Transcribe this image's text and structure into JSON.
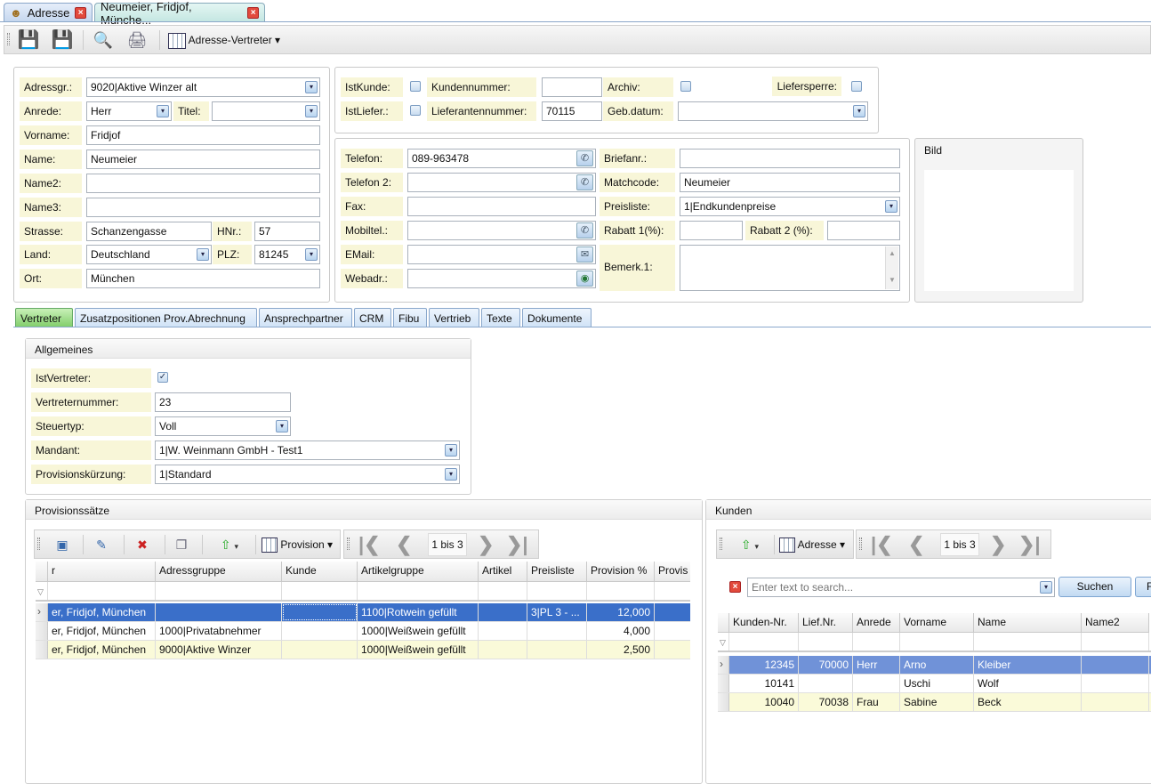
{
  "tabs": [
    {
      "label": "Adresse",
      "icon": "address-book-icon"
    },
    {
      "label": "Neumeier, Fridjof, Münche..."
    }
  ],
  "toolbar": {
    "view_label": "Adresse-Vertreter"
  },
  "address": {
    "adressgr_label": "Adressgr.:",
    "adressgr": "9020|Aktive Winzer alt",
    "anrede_label": "Anrede:",
    "anrede": "Herr",
    "titel_label": "Titel:",
    "titel": "",
    "vorname_label": "Vorname:",
    "vorname": "Fridjof",
    "name_label": "Name:",
    "name": "Neumeier",
    "name2_label": "Name2:",
    "name2": "",
    "name3_label": "Name3:",
    "name3": "",
    "strasse_label": "Strasse:",
    "strasse": "Schanzengasse",
    "hnr_label": "HNr.:",
    "hnr": "57",
    "land_label": "Land:",
    "land": "Deutschland",
    "plz_label": "PLZ:",
    "plz": "81245",
    "ort_label": "Ort:",
    "ort": "München"
  },
  "flags": {
    "istkunde_label": "IstKunde:",
    "istkunde": false,
    "kundennummer_label": "Kundennummer:",
    "kundennummer": "",
    "archiv_label": "Archiv:",
    "archiv": false,
    "liefersperre_label": "Liefersperre:",
    "liefersperre": false,
    "istliefer_label": "IstLiefer.:",
    "istliefer": false,
    "lieferantennummer_label": "Lieferantennummer:",
    "lieferantennummer": "70115",
    "gebdatum_label": "Geb.datum:",
    "gebdatum": ""
  },
  "contact": {
    "telefon_label": "Telefon:",
    "telefon": "089-963478",
    "telefon2_label": "Telefon 2:",
    "telefon2": "",
    "fax_label": "Fax:",
    "fax": "",
    "mobil_label": "Mobiltel.:",
    "mobil": "",
    "email_label": "EMail:",
    "email": "",
    "web_label": "Webadr.:",
    "web": "",
    "briefanr_label": "Briefanr.:",
    "briefanr": "",
    "matchcode_label": "Matchcode:",
    "matchcode": "Neumeier",
    "preisliste_label": "Preisliste:",
    "preisliste": "1|Endkundenpreise",
    "rabatt1_label": "Rabatt 1(%):",
    "rabatt1": "",
    "rabatt2_label": "Rabatt 2 (%):",
    "rabatt2": "",
    "bemerk_label": "Bemerk.1:",
    "bemerk": ""
  },
  "bild_label": "Bild",
  "subtabs": [
    "Vertreter",
    "Zusatzpositionen Prov.Abrechnung",
    "Ansprechpartner",
    "CRM",
    "Fibu",
    "Vertrieb",
    "Texte",
    "Dokumente"
  ],
  "allgemeines": {
    "title": "Allgemeines",
    "istvertreter_label": "IstVertreter:",
    "istvertreter": true,
    "vertreternummer_label": "Vertreternummer:",
    "vertreternummer": "23",
    "steuertyp_label": "Steuertyp:",
    "steuertyp": "Voll",
    "mandant_label": "Mandant:",
    "mandant": "1|W. Weinmann GmbH - Test1",
    "provkuerzung_label": "Provisionskürzung:",
    "provkuerzung": "1|Standard"
  },
  "provision": {
    "title": "Provisionssätze",
    "view_label": "Provision",
    "pager": "1 bis 3",
    "columns": [
      "r",
      "Adressgruppe",
      "Kunde",
      "Artikelgruppe",
      "Artikel",
      "Preisliste",
      "Provision %",
      "Provis"
    ],
    "rows": [
      [
        "er, Fridjof, München",
        "",
        "",
        "1100|Rotwein gefüllt",
        "",
        "3|PL 3 - ...",
        "12,000",
        ""
      ],
      [
        "er, Fridjof, München",
        "1000|Privatabnehmer",
        "",
        "1000|Weißwein gefüllt",
        "",
        "",
        "4,000",
        ""
      ],
      [
        "er, Fridjof, München",
        "9000|Aktive Winzer",
        "",
        "1000|Weißwein gefüllt",
        "",
        "",
        "2,500",
        ""
      ]
    ],
    "selected_row": 0
  },
  "kunden": {
    "title": "Kunden",
    "view_label": "Adresse",
    "pager": "1 bis 3",
    "search_placeholder": "Enter text to search...",
    "search_button": "Suchen",
    "second_button": "F",
    "columns": [
      "Kunden-Nr.",
      "Lief.Nr.",
      "Anrede",
      "Vorname",
      "Name",
      "Name2"
    ],
    "rows": [
      [
        "12345",
        "70000",
        "Herr",
        "Arno",
        "Kleiber",
        ""
      ],
      [
        "10141",
        "",
        "",
        "Uschi",
        "Wolf",
        ""
      ],
      [
        "10040",
        "70038",
        "Frau",
        "Sabine",
        "Beck",
        ""
      ]
    ],
    "selected_row": 0
  },
  "colors": {
    "label_bg": "#f8f6d8",
    "selected_row": "#3a6fc9",
    "selected_row_kunden": "#7092d8",
    "alt_row": "#fafad9",
    "active_tab": "#d3eeea",
    "active_subtab": "#8fd17a"
  }
}
